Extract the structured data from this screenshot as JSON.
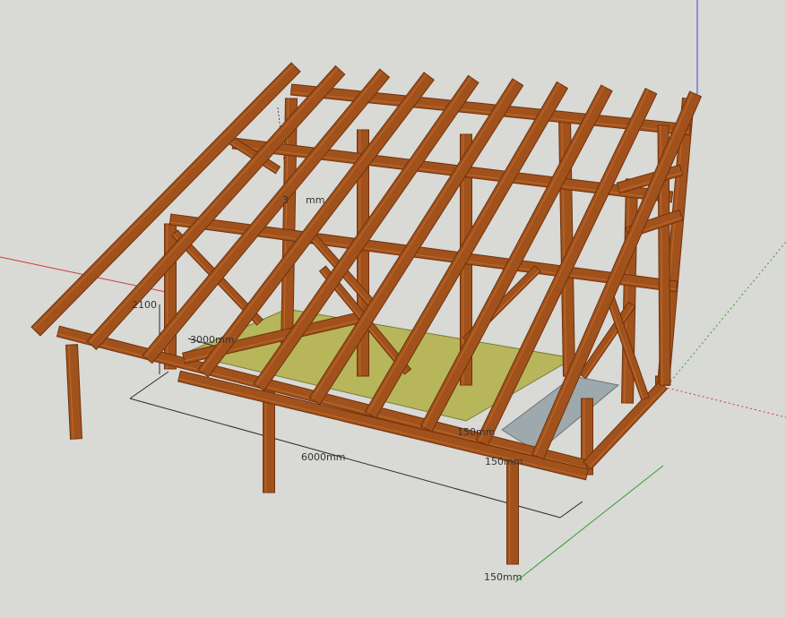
{
  "scene": {
    "background": "#d9d9d6",
    "colors": {
      "timber": "#a1521c",
      "timber_dark": "#6e320d",
      "timber_light": "#c06a2b",
      "floor": "#b7b65b",
      "glass": "#9ea9ad",
      "axis_red": "#d23a3a",
      "axis_green": "#2ea12e",
      "axis_blue": "#3a46d2",
      "dim_line": "#2b2b2b"
    }
  },
  "dimensions": {
    "length": "6000mm",
    "depth": "3000mm",
    "height_low": "2100",
    "height_high": "3",
    "height_high_suffix": "mm",
    "post_a": "150mm",
    "post_b": "150mm",
    "post_c": "150mm"
  }
}
